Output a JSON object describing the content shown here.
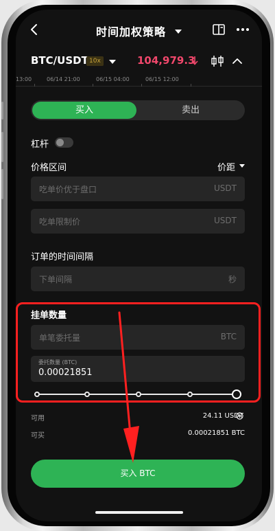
{
  "header": {
    "title": "时间加权策略",
    "back_icon": "chevron-left-icon",
    "book_icon": "book-icon",
    "more_icon": "more-horizontal-icon"
  },
  "market": {
    "pair": "BTC/USDT",
    "leverage_badge": "10x",
    "price": "104,979.3",
    "price_color": "#f0476b",
    "price_direction_icon": "arrow-down-icon",
    "chart_icon": "candlestick-icon",
    "collapse_icon": "chevron-up-icon"
  },
  "timeline": {
    "ticks": [
      "13:00",
      "06/14 21:00",
      "06/15 04:00",
      "06/15 12:00"
    ]
  },
  "tabs": {
    "buy_label": "买入",
    "sell_label": "卖出",
    "active": "buy",
    "accent_color": "#2eb355"
  },
  "leverage": {
    "label": "杠杆",
    "enabled": false
  },
  "price_range": {
    "label": "价格区间",
    "mode_label": "价距",
    "better_than_book": {
      "placeholder": "吃单价优于盘口",
      "unit": "USDT"
    },
    "limit_price": {
      "placeholder": "吃单限制价",
      "unit": "USDT"
    }
  },
  "interval": {
    "label": "订单的时间间隔",
    "placeholder": "下单间隔",
    "unit": "秒"
  },
  "order_qty": {
    "label": "挂单数量",
    "per_order": {
      "placeholder": "单笔委托量",
      "unit": "BTC"
    },
    "total": {
      "label": "委托数量 (BTC)",
      "value": "0.00021851"
    },
    "slider_percent": 100
  },
  "info": {
    "available_label": "可用",
    "available_value": "24.11 USDT",
    "available_icon": "plus-circle-icon",
    "buyable_label": "可买",
    "buyable_value": "0.00021851 BTC"
  },
  "submit": {
    "label": "买入 BTC"
  },
  "annotation": {
    "highlight_color": "#ff2020"
  }
}
